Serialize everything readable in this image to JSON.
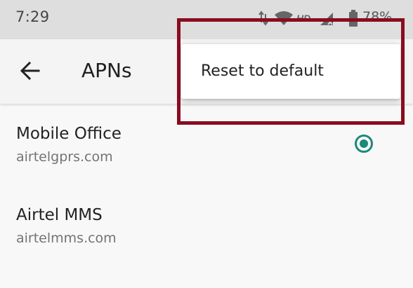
{
  "status_bar": {
    "time": "7:29",
    "battery_level": "78%",
    "icons": [
      "data-arrows-icon",
      "wifi-icon",
      "hd-icon",
      "signal-icon",
      "battery-icon"
    ]
  },
  "app_bar": {
    "title": "APNs"
  },
  "apns": [
    {
      "name": "Mobile Office",
      "url": "airtelgprs.com",
      "selected": true
    },
    {
      "name": "Airtel MMS",
      "url": "airtelmms.com",
      "selected": false
    }
  ],
  "overflow_menu": {
    "items": [
      {
        "label": "Reset to default"
      }
    ]
  },
  "colors": {
    "accent": "#1b8a7a",
    "highlight_border": "#8a0c1f",
    "status_bar_bg": "#dedede",
    "app_bar_bg": "#f4f4f4",
    "background": "#f8f8f8"
  }
}
